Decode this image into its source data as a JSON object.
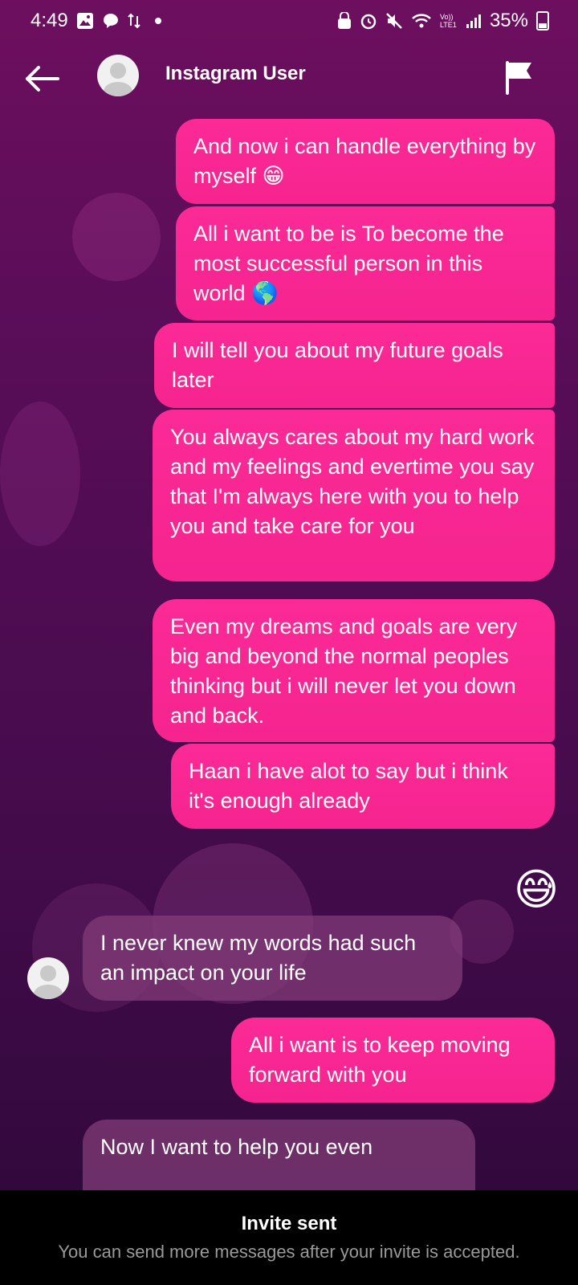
{
  "status_bar": {
    "time": "4:49",
    "battery": "35%",
    "network_label": "Vo)) LTE1"
  },
  "header": {
    "name": "Instagram User",
    "back_icon": "back-arrow-icon",
    "flag_icon": "flag-icon"
  },
  "messages": [
    {
      "side": "sent",
      "text": "And now i can handle everything by myself 😁"
    },
    {
      "side": "sent",
      "text": "All i want to be is To become the most successful person in this world 🌎"
    },
    {
      "side": "sent",
      "text": "I will tell you about my future goals later"
    },
    {
      "side": "sent",
      "text": "You always cares about my hard work and my feelings and evertime you say that I'm always here with you to help you and take care for you"
    },
    {
      "side": "sent",
      "text": "Even my dreams and goals are very big and beyond the normal peoples thinking but i will never let you down and back."
    },
    {
      "side": "sent",
      "text": "Haan i have alot to say but i think it's enough already"
    },
    {
      "side": "sent",
      "text": "😅"
    },
    {
      "side": "received",
      "text": "I never knew my words had such an impact on your life"
    },
    {
      "side": "sent",
      "text": "All i want is to keep moving forward with you"
    },
    {
      "side": "received",
      "text": "Now I want to help you even"
    }
  ],
  "footer": {
    "title": "Invite sent",
    "subtitle": "You can send more messages after your invite is accepted."
  },
  "colors": {
    "sent_bubble": "#f7279a",
    "received_bubble": "#6a2a68",
    "background_top": "#6d0f5e",
    "background_bottom": "#2e0838"
  }
}
